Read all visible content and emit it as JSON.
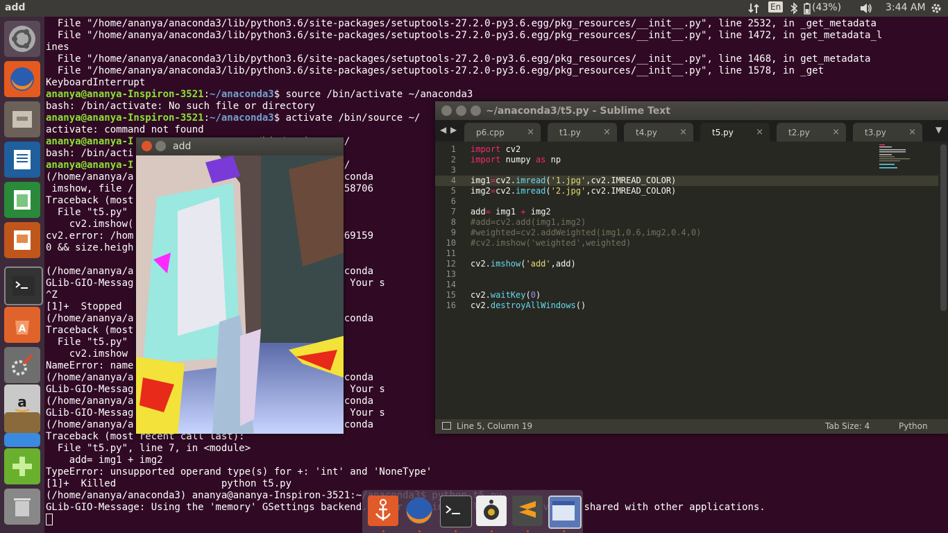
{
  "topbar": {
    "app_title": "add",
    "keyboard_layout": "En",
    "battery": "(43%)",
    "clock": "3:44 AM"
  },
  "launcher": {
    "items": [
      "ubuntu-dash-icon",
      "firefox-icon",
      "files-icon",
      "writer-icon",
      "calc-icon",
      "impress-icon",
      "terminal-icon",
      "software-center-icon",
      "system-settings-icon",
      "amazon-icon",
      "stack-icon",
      "chrome-icon",
      "add-icon",
      "trash-icon"
    ]
  },
  "terminal": {
    "lines": [
      {
        "text": "  File \"/home/ananya/anaconda3/lib/python3.6/site-packages/setuptools-27.2.0-py3.6.egg/pkg_resources/__init__.py\", line 2532, in _get_metadata"
      },
      {
        "text": "  File \"/home/ananya/anaconda3/lib/python3.6/site-packages/setuptools-27.2.0-py3.6.egg/pkg_resources/__init__.py\", line 1472, in get_metadata_l"
      },
      {
        "text": "ines"
      },
      {
        "text": "  File \"/home/ananya/anaconda3/lib/python3.6/site-packages/setuptools-27.2.0-py3.6.egg/pkg_resources/__init__.py\", line 1468, in get_metadata"
      },
      {
        "text": "  File \"/home/ananya/anaconda3/lib/python3.6/site-packages/setuptools-27.2.0-py3.6.egg/pkg_resources/__init__.py\", line 1578, in _get"
      },
      {
        "text": "KeyboardInterrupt"
      },
      {
        "user": "ananya@ananya-Inspiron-3521",
        "path": "~/anaconda3",
        "text": "$ source /bin/activate ~/anaconda3"
      },
      {
        "text": "bash: /bin/activate: No such file or directory"
      },
      {
        "user": "ananya@ananya-Inspiron-3521",
        "path": "~/anaconda3",
        "text": "$ activate /bin/source ~/"
      },
      {
        "text": "activate: command not found"
      },
      {
        "user": "ananya@ananya-I",
        "path": "",
        "text": "                     /bin/activate ~/"
      },
      {
        "text": "bash: /bin/acti"
      },
      {
        "user": "ananya@ananya-I",
        "path": "",
        "text": "                      bin/activate ~/"
      },
      {
        "text": "(/home/ananya/a                          3521:~/anaconda"
      },
      {
        "text": " imshow, file /                          conda_148658706"
      },
      {
        "text": "Traceback (most"
      },
      {
        "text": "  File \"t5.py\""
      },
      {
        "text": "    cv2.imshow("
      },
      {
        "text": "cv2.error: /hom                          a_1486587069159"
      },
      {
        "text": "0 && size.heigh"
      },
      {
        "text": ""
      },
      {
        "text": "(/home/ananya/a                          3521:~/anaconda"
      },
      {
        "text": "GLib-GIO-Messag                           backend.  Your s"
      },
      {
        "text": "^Z"
      },
      {
        "text": "[1]+  Stopped"
      },
      {
        "text": "(/home/ananya/a                          3521:~/anaconda"
      },
      {
        "text": "Traceback (most"
      },
      {
        "text": "  File \"t5.py\""
      },
      {
        "text": "    cv2.imshow"
      },
      {
        "text": "NameError: name"
      },
      {
        "text": "(/home/ananya/a                          3521:~/anaconda"
      },
      {
        "text": "GLib-GIO-Messag                           backend.  Your s"
      },
      {
        "text": "(/home/ananya/a                          3521:~/anaconda"
      },
      {
        "text": "GLib-GIO-Messag                           backend.  Your s"
      },
      {
        "text": "(/home/ananya/a                          3521:~/anaconda"
      },
      {
        "text": "Traceback (most recent call last):"
      },
      {
        "text": "  File \"t5.py\", line 7, in <module>"
      },
      {
        "text": "    add= img1 + img2"
      },
      {
        "text": "TypeError: unsupported operand type(s) for +: 'int' and 'NoneType'"
      },
      {
        "text": "[1]+  Killed                  python t5.py"
      },
      {
        "text": "(/home/ananya/anaconda3) ananya@ananya-Inspiron-3521:~/anaconda3$ python t5.py"
      },
      {
        "text": "GLib-GIO-Message: Using the 'memory' GSettings backend.  Your settings will not be saved or shared with other applications."
      }
    ]
  },
  "image_window": {
    "title": "add"
  },
  "sublime": {
    "title": "~/anaconda3/t5.py - Sublime Text",
    "tabs": [
      {
        "label": "p6.cpp",
        "close": "×"
      },
      {
        "label": "t1.py",
        "close": "×"
      },
      {
        "label": "t4.py",
        "close": "×"
      },
      {
        "label": "t5.py",
        "close": "×"
      },
      {
        "label": "t2.py",
        "close": "×"
      },
      {
        "label": "t3.py",
        "close": "×"
      }
    ],
    "line_numbers": [
      "1",
      "2",
      "3",
      "4",
      "5",
      "6",
      "7",
      "8",
      "9",
      "10",
      "11",
      "12",
      "13",
      "14",
      "15",
      "16"
    ],
    "status_position": "Line 5, Column 19",
    "tab_size": "Tab Size: 4",
    "syntax": "Python"
  }
}
